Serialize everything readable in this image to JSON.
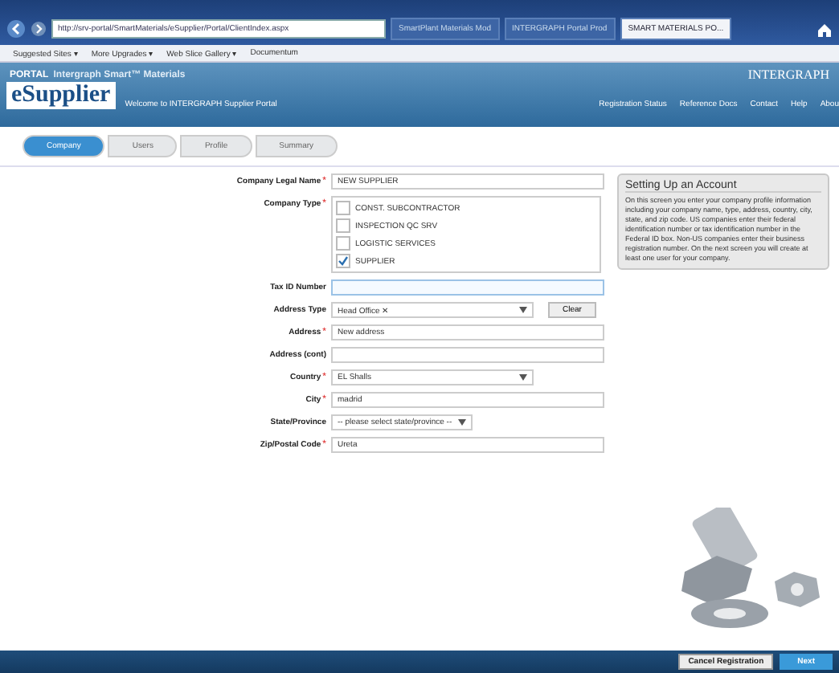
{
  "browser": {
    "address": "http://srv-portal/SmartMaterials/eSupplier/Portal/ClientIndex.aspx",
    "tabs": [
      {
        "label": "SmartPlant Materials Mod",
        "selected": false
      },
      {
        "label": "INTERGRAPH Portal Prod",
        "selected": false
      },
      {
        "label": "SMART MATERIALS PO...",
        "selected": true
      }
    ],
    "favorites": [
      "Suggested Sites ▾",
      "More Upgrades ▾",
      "Web Slice Gallery ▾",
      "Documentum"
    ]
  },
  "header": {
    "portal_label": "PORTAL",
    "product": "Intergraph Smart™ Materials",
    "logo": "eSupplier",
    "welcome": "Welcome to INTERGRAPH Supplier Portal",
    "brand": "INTERGRAPH",
    "nav": [
      "Registration Status",
      "Reference Docs",
      "Contact",
      "Help",
      "Abou"
    ]
  },
  "steps": [
    {
      "label": "Company",
      "selected": true
    },
    {
      "label": "Users",
      "selected": false
    },
    {
      "label": "Profile",
      "selected": false
    },
    {
      "label": "Summary",
      "selected": false
    }
  ],
  "form": {
    "fields": [
      {
        "kind": "text",
        "label": "Company Legal Name",
        "required_mark": "*",
        "value": "NEW SUPPLIER"
      },
      {
        "kind": "checklist",
        "label": "Company Type",
        "required_mark": "*",
        "options": [
          {
            "label": "CONST. SUBCONTRACTOR",
            "checked": false
          },
          {
            "label": "INSPECTION QC SRV",
            "checked": false
          },
          {
            "label": "LOGISTIC SERVICES",
            "checked": false
          },
          {
            "label": "SUPPLIER",
            "checked": true
          }
        ]
      },
      {
        "kind": "text",
        "label": "Tax ID Number",
        "focused": true
      },
      {
        "kind": "select",
        "label": "Address Type",
        "value": "Head Office ✕",
        "button": "Clear",
        "wide": true
      },
      {
        "kind": "text",
        "label": "Address",
        "required_mark": "*",
        "value": "New address"
      },
      {
        "kind": "text",
        "label": "Address (cont)"
      },
      {
        "kind": "select",
        "label": "Country",
        "required_mark": "*",
        "value": "EL Shalls",
        "wide": true
      },
      {
        "kind": "text",
        "label": "City",
        "required_mark": "*",
        "value": "madrid"
      },
      {
        "kind": "select",
        "label": "State/Province",
        "value": "-- please select state/province --",
        "wide": false
      },
      {
        "kind": "text",
        "label": "Zip/Postal Code",
        "required_mark": "*",
        "value": "Ureta"
      }
    ]
  },
  "help": {
    "title": "Setting Up an Account",
    "text": "On this screen you enter your company profile information including your company name, type, address, country, city, state, and zip code. US companies enter their federal identification number or tax identification number in the Federal ID box. Non-US companies enter their business registration number. On the next screen you will create at least one user for your company."
  },
  "footer": {
    "buttons": [
      {
        "label": "Cancel Registration",
        "kind": "secondary"
      },
      {
        "label": "Next",
        "kind": "primary"
      }
    ]
  }
}
